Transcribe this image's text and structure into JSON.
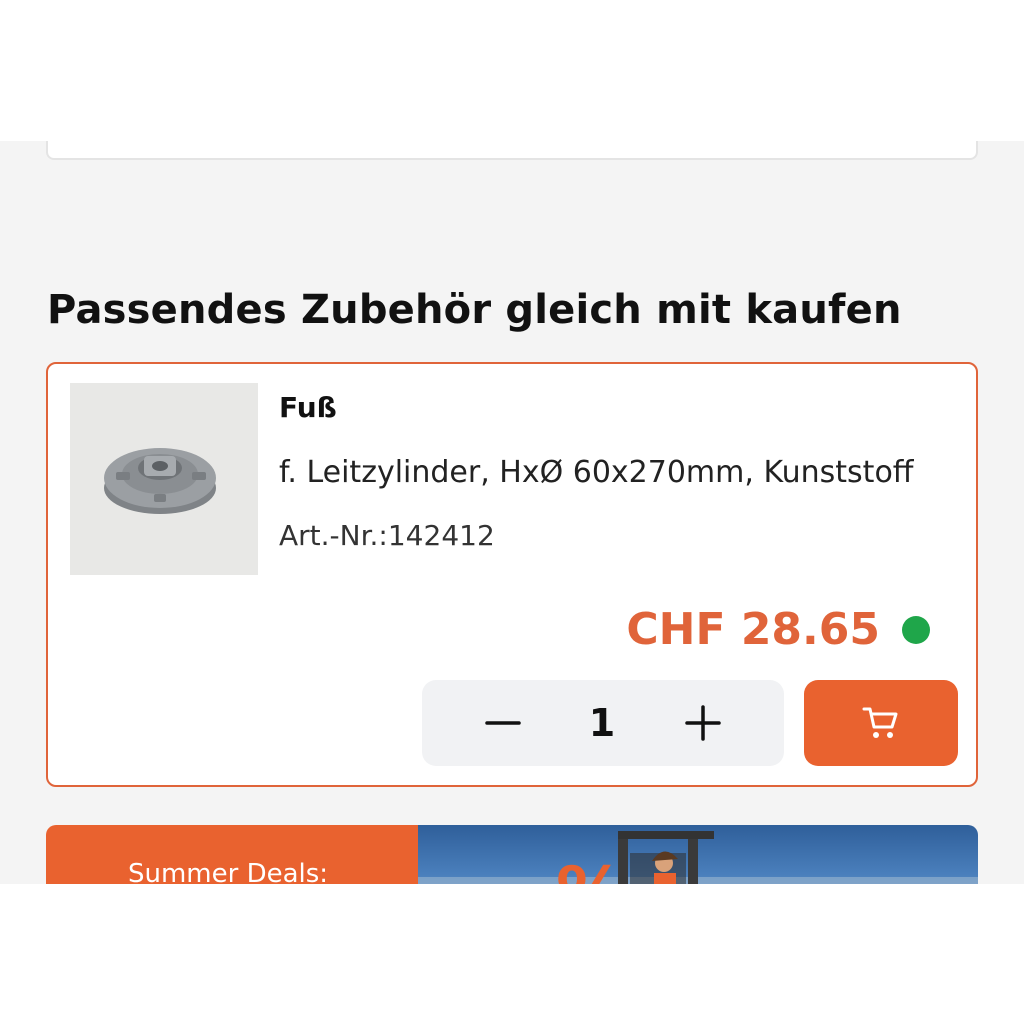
{
  "section": {
    "title": "Passendes Zubehör gleich mit kaufen"
  },
  "product": {
    "name": "Fuß",
    "description": "f. Leitzylinder, HxØ 60x270mm, Kunststoff",
    "article_number": "Art.-Nr.:142412",
    "price": "CHF 28.65",
    "stock_status_color": "#1fa64a",
    "quantity": "1",
    "image_icon": "plastic-foot-part",
    "cart_icon": "shopping-cart-icon"
  },
  "banner": {
    "label": "Summer Deals:"
  },
  "colors": {
    "accent": "#e9622f",
    "price": "#e0643a",
    "in_stock": "#1fa64a"
  }
}
